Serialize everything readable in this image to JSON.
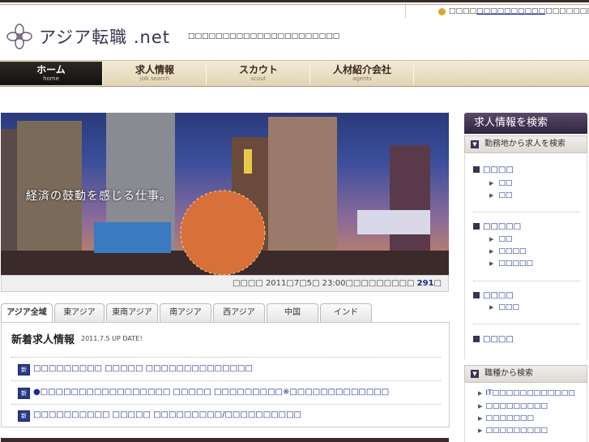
{
  "header": {
    "logo_text": "アジア転職 .net",
    "tagline": "□□□□□□□□□□□□□□□□□□□□□□",
    "right_pre": "□□□□",
    "right_link": "□□□□□□□□□□",
    "right_post": "□□□□□□□□□□"
  },
  "nav": [
    {
      "jp": "ホーム",
      "en": "home"
    },
    {
      "jp": "求人情報",
      "en": "job search"
    },
    {
      "jp": "スカウト",
      "en": "scout"
    },
    {
      "jp": "人材紹介会社",
      "en": "agents"
    }
  ],
  "hero": {
    "caption": "経済の鼓動を感じる仕事。",
    "status_pre": "□□□□ 2011□7□5□ 23:00□□□□□□□□□ ",
    "status_count": "291",
    "status_post": "□"
  },
  "tabs": [
    "アジア全域",
    "東アジア",
    "東南アジア",
    "南アジア",
    "西アジア",
    "中国",
    "インド"
  ],
  "news": {
    "title": "新着求人情報",
    "date": "2011.7.5 UP DATE！",
    "icon_label": "新",
    "jobs": [
      "□□□□□□□□□ □□□□□ □□□□□□□□□□□□□□",
      "●□□□□□□□□□□□□□□□□□ □□□□□ □□□□□□□□□※□□□□□□□□□□□□□",
      "□□□□□□□□□□ □□□□□ □□□□□□□□□/□□□□□□□□□□"
    ]
  },
  "sidebar": {
    "title": "求人情報を検索",
    "by_location": "勤務地から求人を検索",
    "by_category": "職種から検索",
    "regions": [
      {
        "name": "□□□□",
        "subs": [
          "□□",
          "□□"
        ]
      },
      {
        "name": "□□□□□",
        "subs": [
          "□□",
          "□□□□",
          "□□□□□"
        ]
      },
      {
        "name": "□□□□",
        "subs": [
          "□□□"
        ]
      },
      {
        "name": "□□□□",
        "subs": []
      }
    ],
    "categories": [
      "IT□□□□□□□□□□□□",
      "□□□□□□□□□",
      "□□□□□□□",
      "□□□□□□□□□"
    ]
  },
  "colors": {
    "brand": "#3b3350",
    "link": "#1a2a8a",
    "nav_active": "#1c1a16"
  }
}
